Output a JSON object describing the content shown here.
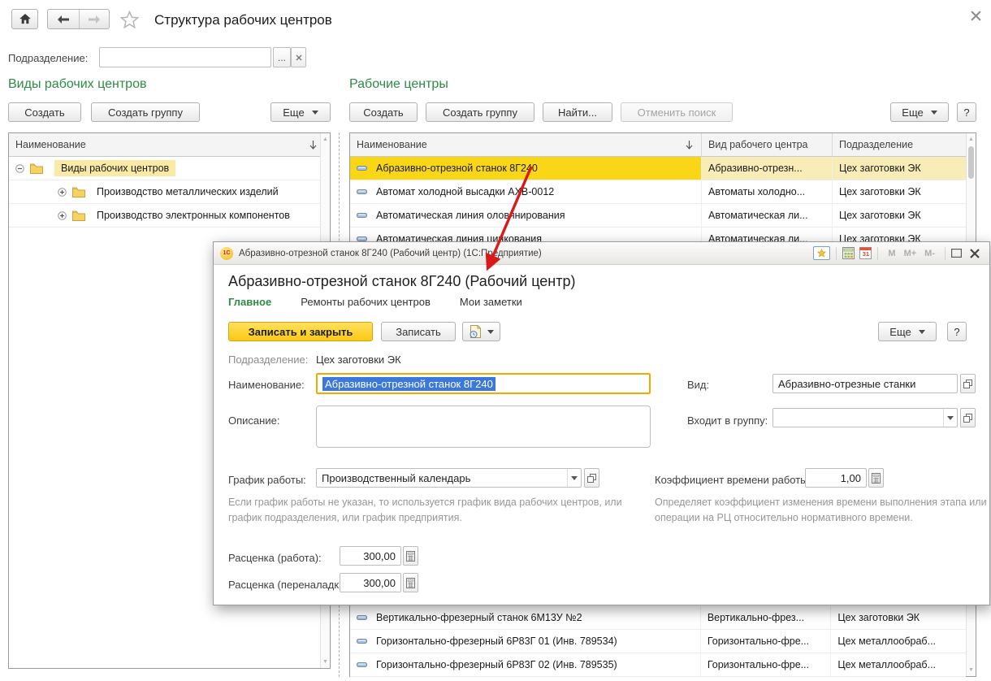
{
  "app": {
    "title": "Структура рабочих центров",
    "filter": {
      "label": "Подразделение:",
      "value": "",
      "ellipsis": "...",
      "clear": "×"
    }
  },
  "left": {
    "title": "Виды рабочих центров",
    "buttons": {
      "create": "Создать",
      "create_group": "Создать группу",
      "more": "Еще"
    },
    "column": "Наименование",
    "tree": {
      "root": "Виды рабочих центров",
      "children": [
        "Производство металлических изделий",
        "Производство электронных компонентов"
      ]
    }
  },
  "right": {
    "title": "Рабочие центры",
    "buttons": {
      "create": "Создать",
      "create_group": "Создать группу",
      "find": "Найти...",
      "cancel_search": "Отменить поиск",
      "more": "Еще",
      "help": "?"
    },
    "columns": [
      "Наименование",
      "Вид рабочего центра",
      "Подразделение"
    ],
    "rows_top": [
      {
        "name": "Абразивно-отрезной станок 8Г240",
        "type": "Абразивно-отрезн...",
        "dept": "Цех заготовки ЭК",
        "selected": true
      },
      {
        "name": "Автомат холодной высадки АХВ-0012",
        "type": "Автоматы холодно...",
        "dept": "Цех заготовки ЭК",
        "selected": false
      },
      {
        "name": "Автоматическая линия оловянирования",
        "type": "Автоматическая ли...",
        "dept": "Цех заготовки ЭК",
        "selected": false
      },
      {
        "name": "Автоматическая линия цинкования",
        "type": "Автоматическая ли...",
        "dept": "Цех заготовки ЭК",
        "selected": false
      }
    ],
    "rows_bottom": [
      {
        "name": "Вертикально-фрезерный станок 6М13У №2",
        "type": "Вертикально-фрез...",
        "dept": "Цех заготовки ЭК"
      },
      {
        "name": "Горизонтально-фрезерный 6Р83Г 01 (Инв. 789534)",
        "type": "Горизонтально-фре...",
        "dept": "Цех металлообраб..."
      },
      {
        "name": "Горизонтально-фрезерный 6Р83Г 02 (Инв. 789535)",
        "type": "Горизонтально-фре...",
        "dept": "Цех металлообраб..."
      }
    ]
  },
  "dialog": {
    "titlebar": {
      "logo": "1С",
      "text": "Абразивно-отрезной станок 8Г240 (Рабочий центр) (1С:Предприятие)",
      "memory": [
        "M",
        "M+",
        "M-"
      ],
      "calendar_day": "31"
    },
    "heading": "Абразивно-отрезной станок 8Г240 (Рабочий центр)",
    "tabs": [
      "Главное",
      "Ремонты рабочих центров",
      "Мои заметки"
    ],
    "toolbar": {
      "save_close": "Записать и закрыть",
      "save": "Записать",
      "more": "Еще",
      "help": "?"
    },
    "fields": {
      "department_label": "Подразделение:",
      "department_value": "Цех заготовки ЭК",
      "name_label": "Наименование:",
      "name_value": "Абразивно-отрезной станок 8Г240",
      "kind_label": "Вид:",
      "kind_value": "Абразивно-отрезные станки",
      "description_label": "Описание:",
      "description_value": "",
      "group_label": "Входит в группу:",
      "group_value": "",
      "schedule_label": "График работы:",
      "schedule_value": "Производственный календарь",
      "schedule_hint": "Если график работы не указан, то используется график вида рабочих центров, или график подразделения, или график предприятия.",
      "coeff_label": "Коэффициент времени работы:",
      "coeff_value": "1,00",
      "coeff_hint": "Определяет коэффициент изменения времени выполнения этапа или операции на РЦ относительно нормативного времени.",
      "rate_work_label": "Расценка (работа):",
      "rate_work_value": "300,00",
      "rate_setup_label": "Расценка (переналадка):",
      "rate_setup_value": "300,00"
    }
  },
  "colors": {
    "accent_green": "#2d8b46",
    "selected_row_yellow": "#f9d716",
    "selected_row_pale": "#f8edb7",
    "focus_border": "#eeab00",
    "arrow_red": "#d81a1a"
  }
}
